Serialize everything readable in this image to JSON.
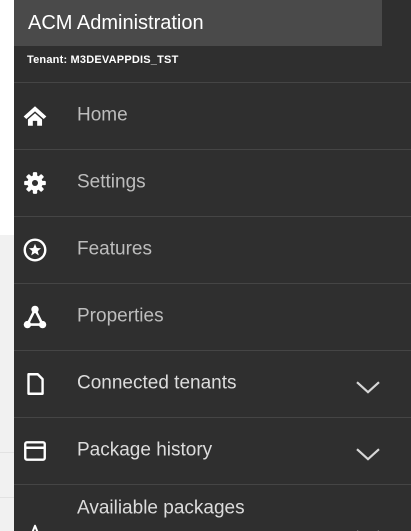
{
  "app": {
    "title": "ACM Administration"
  },
  "tenant": {
    "label": "Tenant: M3DEVAPPDIS_TST"
  },
  "menu": {
    "items": [
      {
        "label": "Home",
        "icon": "home-icon",
        "expandable": false
      },
      {
        "label": "Settings",
        "icon": "gear-icon",
        "expandable": false
      },
      {
        "label": "Features",
        "icon": "star-circle-icon",
        "expandable": false
      },
      {
        "label": "Properties",
        "icon": "nodes-icon",
        "expandable": false
      },
      {
        "label": "Connected tenants",
        "icon": "document-icon",
        "expandable": true,
        "chevron": "chevron-down-icon"
      },
      {
        "label": "Package history",
        "icon": "window-icon",
        "expandable": true,
        "chevron": "chevron-down-icon"
      },
      {
        "label": "Availiable packages",
        "icon": "star-outline-icon",
        "expandable": true,
        "chevron": "chevron-down-icon"
      }
    ]
  },
  "colors": {
    "sidebar_bg": "#2f2f2f",
    "header_bg": "#4a4a4a",
    "divider": "#454545",
    "label_text": "#bdbdbd",
    "icon": "#ffffff"
  }
}
